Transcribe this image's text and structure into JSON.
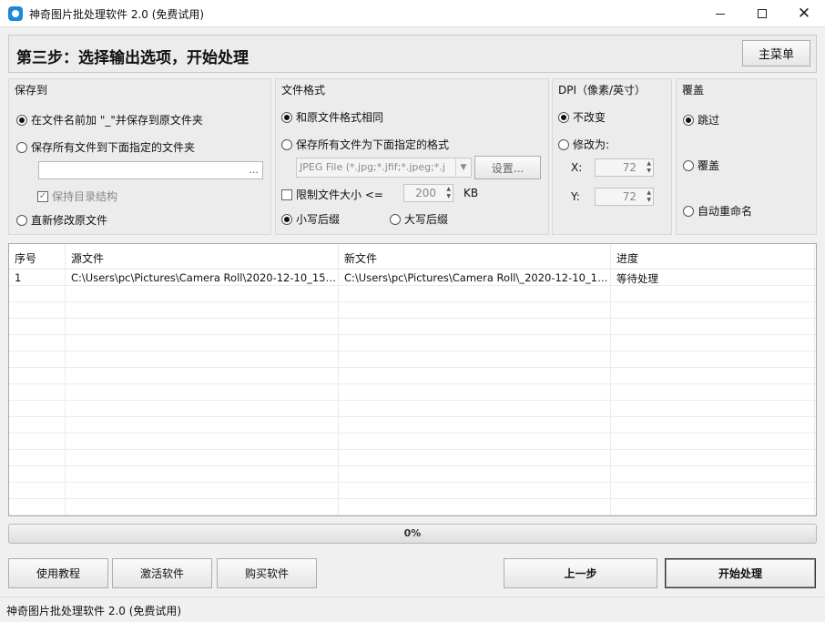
{
  "window": {
    "title": "神奇图片批处理软件 2.0 (免费试用)",
    "icon": "app-logo-icon"
  },
  "header": {
    "step_title": "第三步：选择输出选项，开始处理",
    "main_menu_label": "主菜单"
  },
  "save_to": {
    "title": "保存到",
    "option_prefix": "在文件名前加 \"_\"并保存到原文件夹",
    "option_folder": "保存所有文件到下面指定的文件夹",
    "folder_value": "",
    "browse_label": "...",
    "keep_structure": "保持目录结构",
    "option_overwrite_source": "直新修改原文件",
    "selected": "prefix"
  },
  "file_format": {
    "title": "文件格式",
    "option_same": "和原文件格式相同",
    "option_specified": "保存所有文件为下面指定的格式",
    "format_value": "JPEG File (*.jpg;*.jfif;*.jpeg;*.j",
    "settings_label": "设置...",
    "limit_size_label": "限制文件大小 <=",
    "limit_size_value": "200",
    "limit_size_unit": "KB",
    "limit_size_checked": false,
    "option_lower_ext": "小写后缀",
    "option_upper_ext": "大写后缀",
    "selected": "same",
    "ext_selected": "lower"
  },
  "dpi": {
    "title": "DPI（像素/英寸）",
    "option_keep": "不改变",
    "option_change": "修改为:",
    "x_label": "X:",
    "x_value": "72",
    "y_label": "Y:",
    "y_value": "72",
    "selected": "keep"
  },
  "overwrite": {
    "title": "覆盖",
    "option_skip": "跳过",
    "option_overwrite": "覆盖",
    "option_rename": "自动重命名",
    "selected": "skip"
  },
  "table": {
    "columns": [
      "序号",
      "源文件",
      "新文件",
      "进度"
    ],
    "rows": [
      [
        "1",
        "C:\\Users\\pc\\Pictures\\Camera Roll\\2020-12-10_152...",
        "C:\\Users\\pc\\Pictures\\Camera Roll\\_2020-12-10_15...",
        "等待处理"
      ]
    ]
  },
  "progress": {
    "value": 0,
    "label": "0%"
  },
  "buttons": {
    "tutorial": "使用教程",
    "activate": "激活软件",
    "buy": "购买软件",
    "previous": "上一步",
    "start": "开始处理"
  },
  "status": {
    "text": "神奇图片批处理软件 2.0 (免费试用)"
  }
}
